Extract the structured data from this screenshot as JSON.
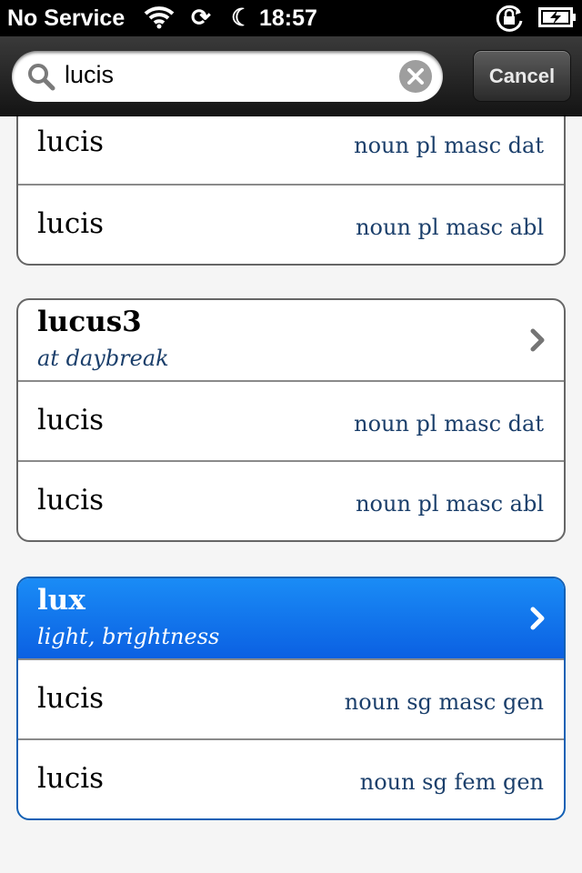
{
  "status_bar": {
    "carrier": "No Service",
    "time": "18:57",
    "icons": [
      "wifi-icon",
      "sync-icon",
      "moon-icon",
      "orientation-lock-icon",
      "battery-charging-icon"
    ]
  },
  "search": {
    "value": "lucis",
    "cancel_label": "Cancel"
  },
  "groups": [
    {
      "rows": [
        {
          "word": "lucis",
          "form": "noun pl masc dat"
        },
        {
          "word": "lucis",
          "form": "noun pl masc abl"
        }
      ]
    },
    {
      "lemma": "lucus3",
      "gloss": "at daybreak",
      "rows": [
        {
          "word": "lucis",
          "form": "noun pl masc dat"
        },
        {
          "word": "lucis",
          "form": "noun pl masc abl"
        }
      ]
    },
    {
      "lemma": "lux",
      "gloss": "light, brightness",
      "selected": true,
      "rows": [
        {
          "word": "lucis",
          "form": "noun sg masc gen"
        },
        {
          "word": "lucis",
          "form": "noun sg fem gen"
        }
      ]
    }
  ],
  "colors": {
    "accent": "#0b60e2",
    "form_text": "#1b3f6b"
  }
}
